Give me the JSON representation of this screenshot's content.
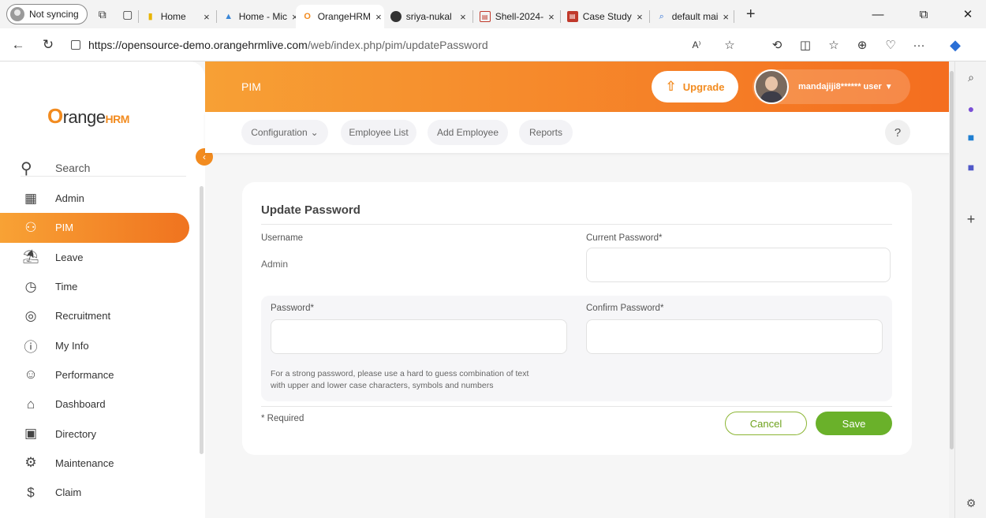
{
  "browser": {
    "profile_label": "Not syncing",
    "tabs": [
      {
        "label": "Home",
        "icon": "folder-icon"
      },
      {
        "label": "Home - Mic",
        "icon": "home-icon"
      },
      {
        "label": "OrangeHRM",
        "icon": "orangehrm-icon",
        "active": true
      },
      {
        "label": "sriya-nukal",
        "icon": "github-icon"
      },
      {
        "label": "Shell-2024-",
        "icon": "pdf-icon"
      },
      {
        "label": "Case Study",
        "icon": "pdf-icon"
      },
      {
        "label": "default mai",
        "icon": "search-icon"
      }
    ],
    "close_glyph": "×",
    "new_tab_glyph": "+",
    "url_host": "https://opensource-demo.orangehrmlive.com",
    "url_path": "/web/index.php/pim/updatePassword",
    "read_aloud_label": "A⁾"
  },
  "app": {
    "logo_o": "O",
    "logo_text": "range",
    "logo_hrm": "HRM",
    "search_label": "Search",
    "menu": [
      {
        "label": "Admin",
        "icon": "admin-icon"
      },
      {
        "label": "PIM",
        "icon": "pim-icon",
        "active": true
      },
      {
        "label": "Leave",
        "icon": "leave-icon"
      },
      {
        "label": "Time",
        "icon": "time-icon"
      },
      {
        "label": "Recruitment",
        "icon": "recruitment-icon"
      },
      {
        "label": "My Info",
        "icon": "my-info-icon"
      },
      {
        "label": "Performance",
        "icon": "performance-icon"
      },
      {
        "label": "Dashboard",
        "icon": "dashboard-icon"
      },
      {
        "label": "Directory",
        "icon": "directory-icon"
      },
      {
        "label": "Maintenance",
        "icon": "maintenance-icon"
      },
      {
        "label": "Claim",
        "icon": "claim-icon"
      }
    ],
    "module_title": "PIM",
    "upgrade_label": "Upgrade",
    "user_name": "mandajiji8****** user",
    "subnav": {
      "configuration": "Configuration",
      "employee_list": "Employee List",
      "add_employee": "Add Employee",
      "reports": "Reports",
      "help": "?"
    },
    "form": {
      "title": "Update Password",
      "username_label": "Username",
      "username_value": "Admin",
      "current_password_label": "Current Password*",
      "password_label": "Password*",
      "confirm_password_label": "Confirm Password*",
      "hint_line1": "For a strong password, please use a hard to guess combination of text",
      "hint_line2": "with upper and lower case characters, symbols and numbers",
      "required_note": "* Required",
      "cancel_label": "Cancel",
      "save_label": "Save"
    }
  },
  "colors": {
    "brand_orange": "#f28b1f",
    "save_green": "#6ab12a"
  }
}
